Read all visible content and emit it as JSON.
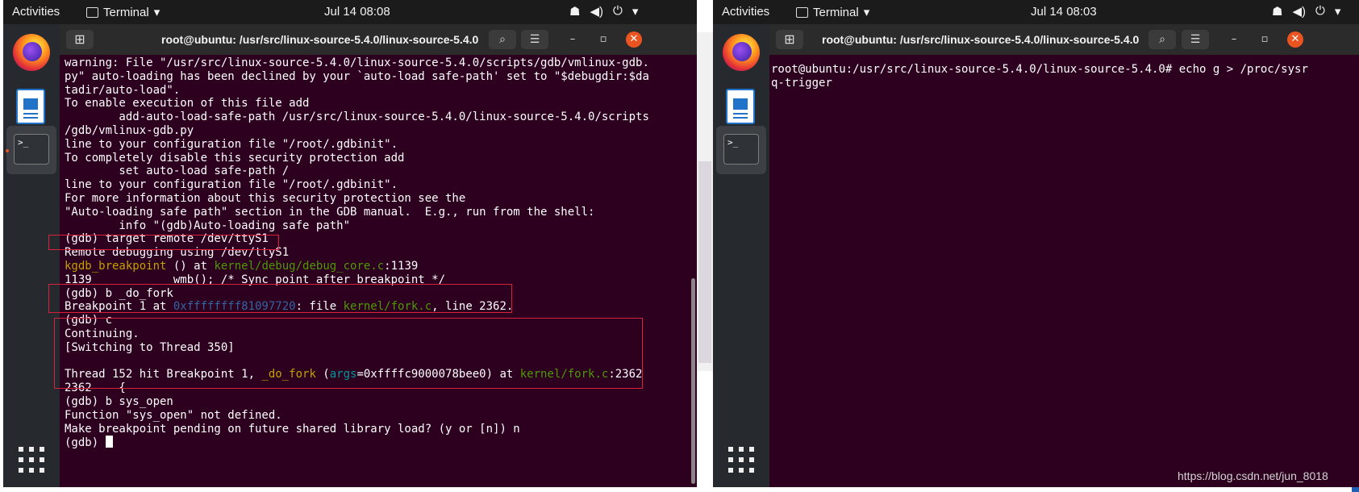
{
  "left_window": {
    "topbar": {
      "activities": "Activities",
      "app": "Terminal",
      "clock": "Jul 14  08:08"
    },
    "title": "root@ubuntu: /usr/src/linux-source-5.4.0/linux-source-5.4.0",
    "lines": [
      [
        {
          "t": "warning: File \"/usr/src/linux-source-5.4.0/linux-source-5.4.0/scripts/gdb/vmlinux-gdb."
        }
      ],
      [
        {
          "t": "py\" auto-loading has been declined by your `auto-load safe-path' set to \"$debugdir:$da"
        }
      ],
      [
        {
          "t": "tadir/auto-load\"."
        }
      ],
      [
        {
          "t": "To enable execution of this file add"
        }
      ],
      [
        {
          "t": "        add-auto-load-safe-path /usr/src/linux-source-5.4.0/linux-source-5.4.0/scripts"
        }
      ],
      [
        {
          "t": "/gdb/vmlinux-gdb.py"
        }
      ],
      [
        {
          "t": "line to your configuration file \"/root/.gdbinit\"."
        }
      ],
      [
        {
          "t": "To completely disable this security protection add"
        }
      ],
      [
        {
          "t": "        set auto-load safe-path /"
        }
      ],
      [
        {
          "t": "line to your configuration file \"/root/.gdbinit\"."
        }
      ],
      [
        {
          "t": "For more information about this security protection see the"
        }
      ],
      [
        {
          "t": "\"Auto-loading safe path\" section in the GDB manual.  E.g., run from the shell:"
        }
      ],
      [
        {
          "t": "        info \"(gdb)Auto-loading safe path\""
        }
      ],
      [
        {
          "t": "(gdb) target remote /dev/ttyS1"
        }
      ],
      [
        {
          "t": "Remote debugging using /dev/ttyS1"
        }
      ],
      [
        {
          "t": "kgdb_breakpoint",
          "c": "y"
        },
        {
          "t": " () at "
        },
        {
          "t": "kernel/debug/debug_core.c",
          "c": "g"
        },
        {
          "t": ":1139"
        }
      ],
      [
        {
          "t": "1139            wmb(); /* Sync point after breakpoint */"
        }
      ],
      [
        {
          "t": "(gdb) b _do_fork"
        }
      ],
      [
        {
          "t": "Breakpoint 1 at "
        },
        {
          "t": "0xffffffff81097720",
          "c": "b"
        },
        {
          "t": ": file "
        },
        {
          "t": "kernel/fork.c",
          "c": "g"
        },
        {
          "t": ", line 2362."
        }
      ],
      [
        {
          "t": "(gdb) c"
        }
      ],
      [
        {
          "t": "Continuing."
        }
      ],
      [
        {
          "t": "[Switching to Thread 350]"
        }
      ],
      [
        {
          "t": ""
        }
      ],
      [
        {
          "t": "Thread 152 hit Breakpoint 1, "
        },
        {
          "t": "_do_fork",
          "c": "y"
        },
        {
          "t": " ("
        },
        {
          "t": "args",
          "c": "c"
        },
        {
          "t": "=0xffffc9000078bee0) at "
        },
        {
          "t": "kernel/fork.c",
          "c": "g"
        },
        {
          "t": ":2362"
        }
      ],
      [
        {
          "t": "2362    {"
        }
      ],
      [
        {
          "t": "(gdb) b sys_open"
        }
      ],
      [
        {
          "t": "Function \"sys_open\" not defined."
        }
      ],
      [
        {
          "t": "Make breakpoint pending on future shared library load? (y or [n]) n"
        }
      ],
      [
        {
          "t": "(gdb) "
        }
      ]
    ]
  },
  "right_window": {
    "topbar": {
      "activities": "Activities",
      "app": "Terminal",
      "clock": "Jul 14  08:03"
    },
    "title": "root@ubuntu: /usr/src/linux-source-5.4.0/linux-source-5.4.0",
    "lines": [
      [
        {
          "t": "root@ubuntu:/usr/src/linux-source-5.4.0/linux-source-5.4.0# echo g > /proc/sysr"
        }
      ],
      [
        {
          "t": "q-trigger"
        }
      ]
    ]
  },
  "icons": {
    "terminal_prompt_glyph": ">_",
    "new_tab": "⊞",
    "search": "⌕",
    "menu": "☰",
    "minimize": "–",
    "maximize": "▫",
    "close": "✕",
    "network": "☗",
    "volume": "◀)",
    "power": "⏻",
    "dropdown": "▾"
  },
  "watermark": "https://blog.csdn.net/jun_8018",
  "colors": {
    "terminal_bg": "#2c001e",
    "highlight_box": "#d9213c",
    "ubuntu_orange": "#e95420",
    "gdb_yellow": "#c4a000",
    "gdb_green": "#4e9a06",
    "gdb_blue": "#3465a4",
    "gdb_cyan": "#06989a"
  }
}
